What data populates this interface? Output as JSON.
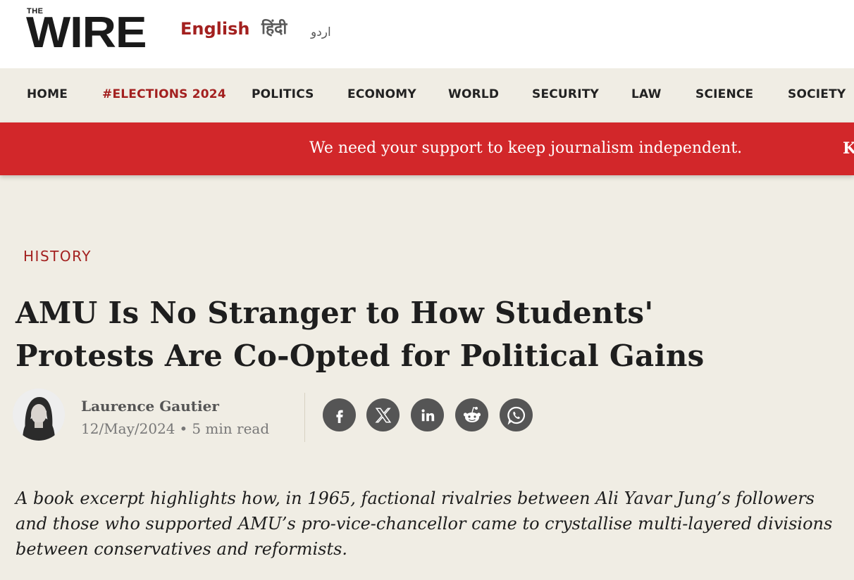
{
  "brand": {
    "small": "THE",
    "name": "WIRE"
  },
  "languages": [
    {
      "label": "English",
      "active": true
    },
    {
      "label": "हिंदी",
      "active": false
    },
    {
      "label": "اردو",
      "active": false
    }
  ],
  "nav": {
    "items": [
      {
        "label": "HOME"
      },
      {
        "label": "#ELECTIONS 2024",
        "active": true
      },
      {
        "label": "POLITICS"
      },
      {
        "label": "ECONOMY"
      },
      {
        "label": "WORLD"
      },
      {
        "label": "SECURITY"
      },
      {
        "label": "LAW"
      },
      {
        "label": "SCIENCE"
      },
      {
        "label": "SOCIETY"
      }
    ]
  },
  "banner": {
    "message": "We need your support to keep journalism independent.",
    "overflow_text": "K"
  },
  "article": {
    "category": "HISTORY",
    "title": "AMU Is No Stranger to How Students' Protests Are Co-Opted for Political Gains",
    "author": "Laurence Gautier",
    "date": "12/May/2024",
    "separator": "•",
    "read_time": "5 min read",
    "dek": "A book excerpt highlights how, in 1965, factional rivalries between Ali Yavar Jung’s followers and those who supported AMU’s pro-vice-chancellor came to crystallise multi-layered divisions between conservatives and reformists."
  },
  "share": [
    {
      "icon": "facebook-icon"
    },
    {
      "icon": "x-icon"
    },
    {
      "icon": "linkedin-icon"
    },
    {
      "icon": "reddit-icon"
    },
    {
      "icon": "whatsapp-icon"
    }
  ],
  "colors": {
    "brand_red": "#d2272a",
    "accent_red": "#a3201f",
    "background": "#f0ede4",
    "icon_gray": "#555555"
  }
}
